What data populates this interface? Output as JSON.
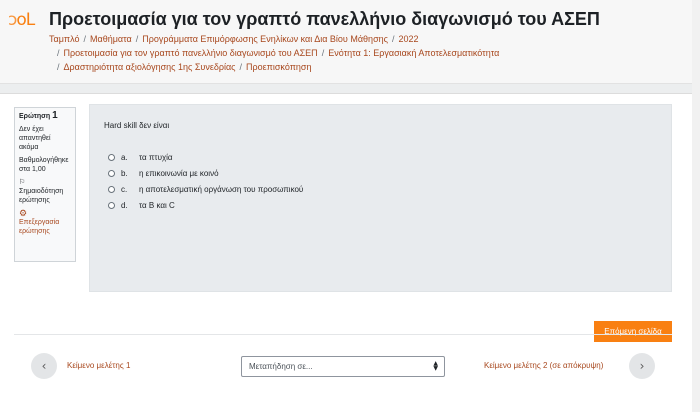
{
  "header": {
    "logo": "oL",
    "title": "Προετοιμασία για τον γραπτό πανελλήνιο διαγωνισμό του ΑΣΕΠ",
    "breadcrumb": [
      "Ταμπλό",
      "Μαθήματα",
      "Προγράμματα Επιμόρφωσης Ενηλίκων και Δια Βίου Μάθησης",
      "2022",
      "Προετοιμασία για τον γραπτό πανελλήνιο διαγωνισμό του ΑΣΕΠ",
      "Ενότητα 1: Εργασιακή Αποτελεσματικότητα",
      "Δραστηριότητα αξιολόγησης 1ης Συνεδρίας",
      "Προεπισκόπηση"
    ]
  },
  "question_info": {
    "label": "Ερώτηση",
    "number": "1",
    "status": "Δεν έχει απαντηθεί ακόμα",
    "grade": "Βαθμολογήθηκε στα 1,00",
    "flag": "Σημαιοδότηση ερώτησης",
    "edit": "Επεξεργασία ερώτησης"
  },
  "question": {
    "text": "Hard skill δεν είναι",
    "answers": [
      {
        "letter": "a.",
        "text": "τα πτυχία"
      },
      {
        "letter": "b.",
        "text": "η επικοινωνία με κοινό"
      },
      {
        "letter": "c.",
        "text": "η αποτελεσματική οργάνωση του προσωπικού"
      },
      {
        "letter": "d.",
        "text": "τα Β και C"
      }
    ]
  },
  "actions": {
    "next_page": "Επόμενη σελίδα"
  },
  "navigation": {
    "prev_label": "Κείμενο μελέτης 1",
    "jump_placeholder": "Μεταπήδηση σε...",
    "next_label": "Κείμενο μελέτης 2 (σε απόκρυψη)"
  },
  "colors": {
    "accent": "#f98012",
    "link": "#a8481e"
  }
}
